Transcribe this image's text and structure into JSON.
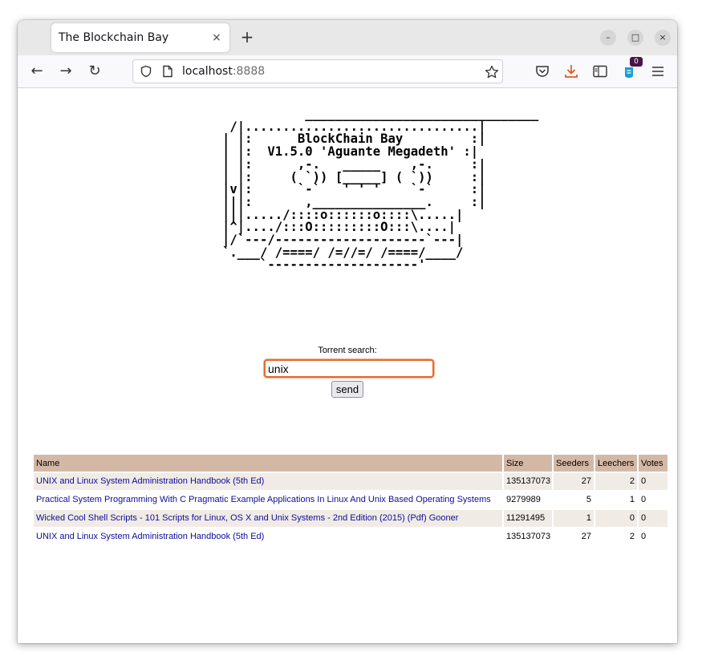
{
  "browser": {
    "tab_title": "The Blockchain Bay",
    "tab_close_icon": "×",
    "new_tab_icon": "+",
    "minimize_icon": "–",
    "maximize_icon": "□",
    "close_icon": "×",
    "back_icon": "←",
    "forward_icon": "→",
    "reload_icon": "↻",
    "url_host": "localhost",
    "url_port": ":8888",
    "extension_badge": "0"
  },
  "page": {
    "ascii_art": "           _______________________________\n /|...............................|\n| |:      BlockChain Bay         :|\n| |:  V1.5.0 'Aguante Megadeth' :|\n| |:      ,-.   _____    ,-.     :|\n| |:     ( `)) [_____] ( `))     :|\n|v|:      `-`   ' ' '    `-`     :|\n|||:       ,_______________.     :|\n|||...../::::o::::::o::::\\.....|\n|^|..../:::O:::::::::O:::\\....|\n|/`---/--------------------`---|\n`.___/ /====/ /=//=/ /====/____/\n     `--------------------'",
    "search_label": "Torrent search:",
    "search_value": "unix",
    "send_label": "send"
  },
  "results": {
    "headers": [
      "Name",
      "Size",
      "Seeders",
      "Leechers",
      "Votes"
    ],
    "rows": [
      {
        "name": "UNIX and Linux System Administration Handbook (5th Ed)",
        "size": "135137073",
        "seeders": "27",
        "leechers": "2",
        "votes": "0"
      },
      {
        "name": "Practical System Programming With C Pragmatic Example Applications In Linux And Unix Based Operating Systems",
        "size": "9279989",
        "seeders": "5",
        "leechers": "1",
        "votes": "0"
      },
      {
        "name": "Wicked Cool Shell Scripts - 101 Scripts for Linux, OS X and Unix Systems - 2nd Edition (2015) (Pdf) Gooner",
        "size": "11291495",
        "seeders": "1",
        "leechers": "0",
        "votes": "0"
      },
      {
        "name": "UNIX and Linux System Administration Handbook (5th Ed)",
        "size": "135137073",
        "seeders": "27",
        "leechers": "2",
        "votes": "0"
      }
    ]
  },
  "colors": {
    "table_header_bg": "#d4b8a6",
    "table_row_alt_bg": "#f1ebe6",
    "link": "#0d0d9a",
    "search_focus_border": "#e66a2c"
  }
}
